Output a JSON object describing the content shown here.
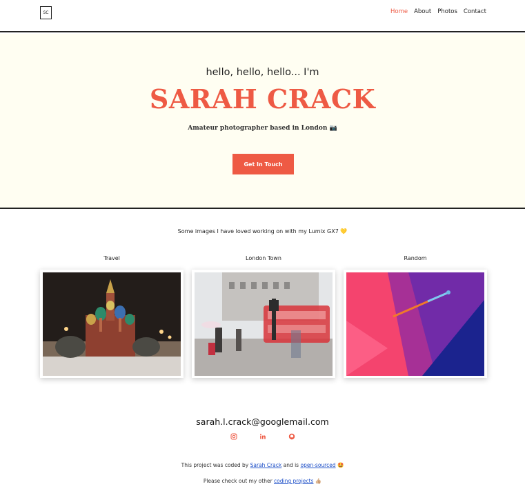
{
  "nav": {
    "logo": "SC",
    "links": [
      {
        "label": "Home",
        "active": true
      },
      {
        "label": "About"
      },
      {
        "label": "Photos"
      },
      {
        "label": "Contact"
      }
    ]
  },
  "hero": {
    "greeting": "hello, hello, hello... I'm",
    "name": "SARAH CRACK",
    "subtitle": "Amateur photographer based in London 📷",
    "cta_label": "Get In Touch"
  },
  "gallery": {
    "intro": "Some images I have loved working on with my Lumix GX7 💛",
    "cards": [
      {
        "title": "Travel",
        "icon": "st-basils-cathedral-photo"
      },
      {
        "title": "London Town",
        "icon": "london-street-bus-photo"
      },
      {
        "title": "Random",
        "icon": "abstract-pink-blue-photo"
      }
    ]
  },
  "contact": {
    "email": "sarah.l.crack@googlemail.com",
    "socials": [
      "instagram-icon",
      "linkedin-icon",
      "github-icon"
    ]
  },
  "footer": {
    "line1_prefix": "This project was coded by",
    "line1_author": "Sarah Crack",
    "line1_middle": "and is",
    "line1_link": "open-sourced",
    "line1_emoji": "🤩",
    "line2_prefix": "Please check out my other",
    "line2_link": "coding projects",
    "line2_emoji": "👍🏼"
  },
  "colors": {
    "accent": "#ee5a44",
    "hero_bg": "#fffef2",
    "link": "#1e50c8"
  }
}
